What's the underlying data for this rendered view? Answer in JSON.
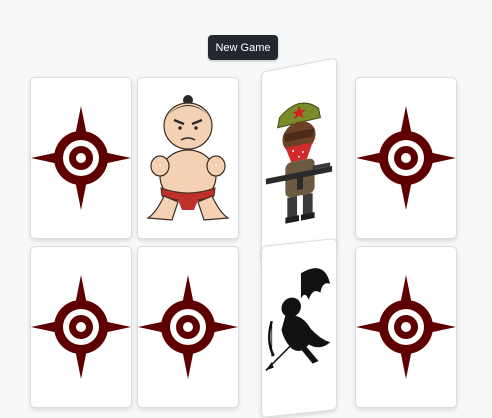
{
  "toolbar": {
    "new_game_label": "New Game"
  },
  "colors": {
    "card_back_emblem": "#5e0000",
    "button_bg": "#22282e",
    "page_bg": "#f7f8fa"
  },
  "board": {
    "rows": [
      [
        {
          "state": "face-down",
          "icon": "crosshair-icon"
        },
        {
          "state": "face-up",
          "icon": "sumo-wrestler-icon"
        },
        {
          "state": "face-up",
          "icon": "soldier-with-rifle-icon"
        },
        {
          "state": "face-down",
          "icon": "crosshair-icon"
        }
      ],
      [
        {
          "state": "face-down",
          "icon": "crosshair-icon"
        },
        {
          "state": "face-down",
          "icon": "crosshair-icon"
        },
        {
          "state": "face-up",
          "icon": "cupid-icon"
        },
        {
          "state": "face-down",
          "icon": "crosshair-icon"
        }
      ]
    ]
  }
}
